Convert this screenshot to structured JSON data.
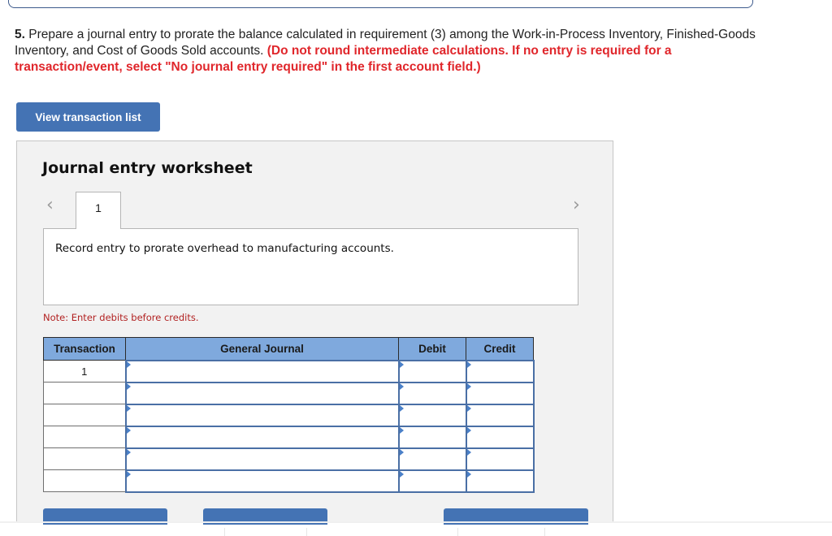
{
  "question": {
    "number": "5.",
    "text": " Prepare a journal entry to prorate the balance calculated in requirement (3) among the Work-in-Process Inventory, Finished-Goods Inventory, and Cost of Goods Sold accounts. ",
    "instruction": "(Do not round intermediate calculations. If no entry is required for a transaction/event, select \"No journal entry required\" in the first account field.)",
    "instruction_color": "#e0262b"
  },
  "view_transaction_button": "View transaction list",
  "worksheet": {
    "title": "Journal entry worksheet",
    "nav": {
      "prev_icon": "chevron-left-icon",
      "prev_glyph": "‹",
      "next_icon": "chevron-right-icon",
      "next_glyph": "›"
    },
    "tabs": [
      {
        "label": "1",
        "active": true
      }
    ],
    "description": "Record entry to prorate overhead to manufacturing accounts.",
    "note": "Note: Enter debits before credits.",
    "table": {
      "headers": [
        "Transaction",
        "General Journal",
        "Debit",
        "Credit"
      ],
      "rows": [
        {
          "transaction": "1",
          "account": "",
          "debit": "",
          "credit": ""
        },
        {
          "transaction": "",
          "account": "",
          "debit": "",
          "credit": ""
        },
        {
          "transaction": "",
          "account": "",
          "debit": "",
          "credit": ""
        },
        {
          "transaction": "",
          "account": "",
          "debit": "",
          "credit": ""
        },
        {
          "transaction": "",
          "account": "",
          "debit": "",
          "credit": ""
        },
        {
          "transaction": "",
          "account": "",
          "debit": "",
          "credit": ""
        }
      ]
    }
  },
  "colors": {
    "button": "#4473b4",
    "table_header": "#7fa9dd",
    "note": "#b22222"
  }
}
